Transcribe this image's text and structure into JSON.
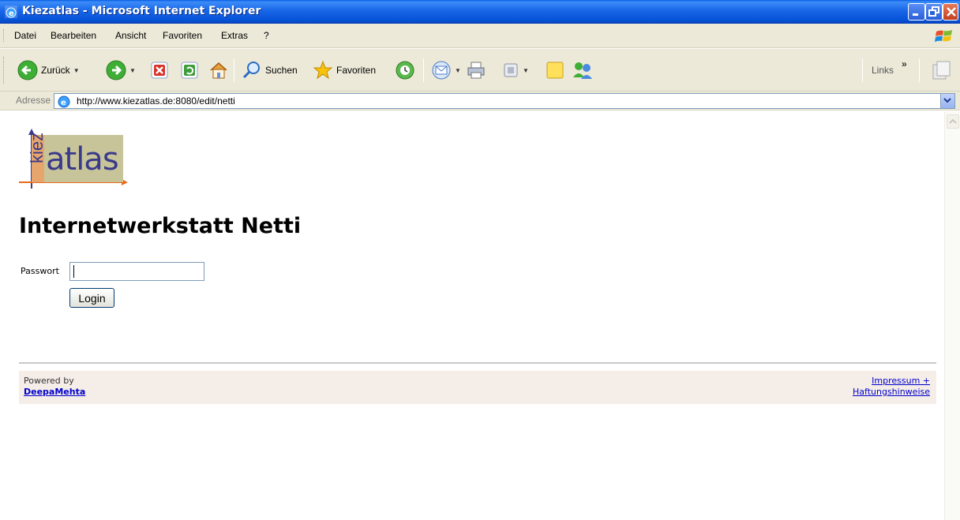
{
  "window": {
    "title": "Kiezatlas - Microsoft Internet Explorer"
  },
  "menu": {
    "items": [
      "Datei",
      "Bearbeiten",
      "Ansicht",
      "Favoriten",
      "Extras",
      "?"
    ]
  },
  "toolbar": {
    "back_label": "Zurück",
    "search_label": "Suchen",
    "favorites_label": "Favoriten",
    "links_label": "Links",
    "icons": [
      "back-icon",
      "forward-icon",
      "stop-icon",
      "refresh-icon",
      "home-icon",
      "search-icon",
      "favorites-icon",
      "history-icon",
      "mail-icon",
      "print-icon",
      "edit-icon",
      "note-icon",
      "messenger-icon"
    ]
  },
  "address": {
    "label": "Adresse",
    "url": "http://www.kiezatlas.de:8080/edit/netti"
  },
  "page": {
    "logo_kiez": "kiez",
    "logo_atlas": "atlas",
    "title": "Internetwerkstatt Netti",
    "password_label": "Passwort",
    "password_value": "",
    "login_label": "Login"
  },
  "footer": {
    "powered_by": "Powered by",
    "deepamehta": "DeepaMehta",
    "impressum_line1": "Impressum +",
    "impressum_line2": "Haftungshinweise"
  },
  "colors": {
    "title_bar": "#0a5ee6",
    "chrome": "#ece9d8",
    "footer_bg": "#f5ede8",
    "link": "#0000cc",
    "logo_text": "#3a3a8a"
  }
}
